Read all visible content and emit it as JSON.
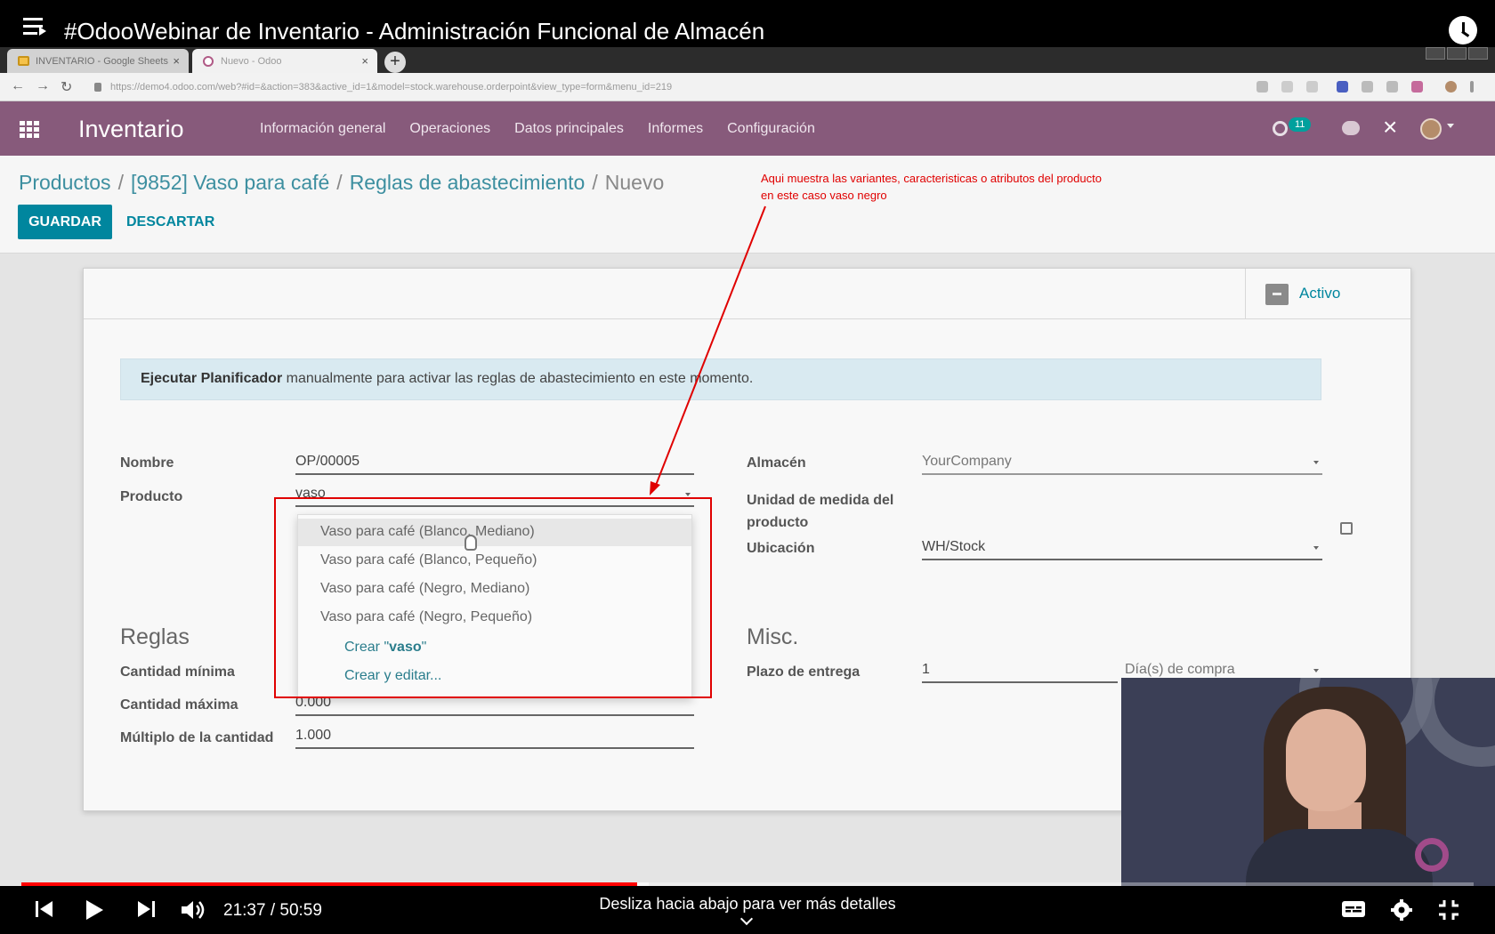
{
  "video": {
    "title": "#OdooWebinar de Inventario - Administración Funcional de Almacén",
    "time_current": "21:37",
    "time_sep": " / ",
    "time_total": "50:59",
    "hint": "Desliza hacia abajo para ver más detalles",
    "progress_played": 0.424,
    "progress_buffered": 0.432
  },
  "browser": {
    "tabs": [
      {
        "label": "INVENTARIO - Google Sheets"
      },
      {
        "label": "Nuevo - Odoo"
      }
    ],
    "url": "https://demo4.odoo.com/web?#id=&action=383&active_id=1&model=stock.warehouse.orderpoint&view_type=form&menu_id=219"
  },
  "odoo": {
    "app_name": "Inventario",
    "menu": [
      "Información general",
      "Operaciones",
      "Datos principales",
      "Informes",
      "Configuración"
    ],
    "activity_badge": "11",
    "breadcrumb": [
      "Productos",
      "[9852] Vaso para café",
      "Reglas de abastecimiento"
    ],
    "breadcrumb_current": "Nuevo",
    "save_label": "GUARDAR",
    "discard_label": "DESCARTAR",
    "active_label": "Activo"
  },
  "form": {
    "alert_bold": "Ejecutar Planificador",
    "alert_text": " manualmente para activar las reglas de abastecimiento en este momento.",
    "nombre_label": "Nombre",
    "nombre_value": "OP/00005",
    "producto_label": "Producto",
    "producto_value": "vaso",
    "almacen_label": "Almacén",
    "almacen_value": "YourCompany",
    "uom_label": "Unidad de medida del producto",
    "ubicacion_label": "Ubicación",
    "ubicacion_value": "WH/Stock",
    "reglas_heading": "Reglas",
    "cant_min_label": "Cantidad mínima",
    "cant_max_label": "Cantidad máxima",
    "cant_max_value": "0.000",
    "multiplo_label": "Múltiplo de la cantidad",
    "multiplo_value": "1.000",
    "misc_heading": "Misc.",
    "plazo_label": "Plazo de entrega",
    "plazo_value": "1",
    "plazo_unit": "Día(s) de compra"
  },
  "dropdown": {
    "items": [
      "Vaso para café (Blanco, Mediano)",
      "Vaso para café (Blanco, Pequeño)",
      "Vaso para café (Negro, Mediano)",
      "Vaso para café (Negro, Pequeño)"
    ],
    "create_prefix": "Crear \"",
    "create_term": "vaso",
    "create_suffix": "\"",
    "create_edit": "Crear y editar..."
  },
  "annotation": {
    "text": "Aqui muestra las variantes, caracteristicas o atributos del producto en este caso vaso negro",
    "color": "#e00000"
  },
  "colors": {
    "odoo_brand": "#875a7b",
    "primary_button": "#00869e",
    "youtube_progress": "#ff0000"
  }
}
